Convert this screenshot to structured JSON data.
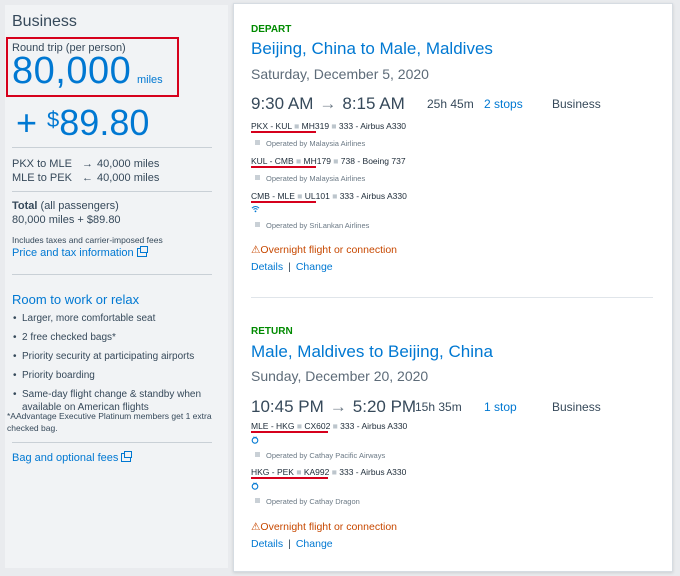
{
  "summary": {
    "cabin_title": "Business",
    "round_trip_label": "Round trip (per person)",
    "miles": "80,000",
    "miles_unit": "miles",
    "price_plus": "+ ",
    "price_dollar": "$",
    "price_amount": "89.80",
    "segments": [
      {
        "route": "PKX to MLE",
        "arrow": "→",
        "miles": "40,000 miles"
      },
      {
        "route": "MLE to PEK",
        "arrow": "←",
        "miles": "40,000 miles"
      }
    ],
    "total_label": "Total",
    "total_suffix": " (all passengers)",
    "total_value": "80,000 miles + $89.80",
    "includes_text": "Includes taxes and carrier-imposed fees",
    "price_tax_link": "Price and tax information",
    "room_heading": "Room to work or relax",
    "perks": [
      "Larger, more comfortable seat",
      "2 free checked bags*",
      "Priority security at participating airports",
      "Priority boarding",
      "Same-day flight change & standby when available on American flights"
    ],
    "footnote": "*AAdvantage Executive Platinum members get 1 extra checked bag.",
    "bag_fees_link": "Bag and optional fees"
  },
  "depart": {
    "label": "DEPART",
    "route": "Beijing, China to Male, Maldives",
    "date": "Saturday, December 5, 2020",
    "depart_time": "9:30 AM",
    "arrow": "→",
    "arrive_time": "8:15 AM",
    "duration": "25h 45m",
    "stops": "2 stops",
    "cabin": "Business",
    "flights": [
      {
        "route": "PKX - KUL",
        "flight": "MH319",
        "aircraft": "333 - Airbus A330",
        "operated": "Operated by Malaysia Airlines",
        "amenity": ""
      },
      {
        "route": "KUL - CMB",
        "flight": "MH179",
        "aircraft": "738 - Boeing 737",
        "operated": "Operated by Malaysia Airlines",
        "amenity": ""
      },
      {
        "route": "CMB - MLE",
        "flight": "UL101",
        "aircraft": "333 - Airbus A330",
        "operated": "Operated by SriLankan Airlines",
        "amenity": "wifi-icon"
      }
    ],
    "warning": "Overnight flight or connection",
    "details": "Details",
    "change": "Change"
  },
  "return": {
    "label": "RETURN",
    "route": "Male, Maldives to Beijing, China",
    "date": "Sunday, December 20, 2020",
    "depart_time": "10:45 PM",
    "arrow": "→",
    "arrive_time": "5:20 PM",
    "duration": "15h 35m",
    "stops": "1 stop",
    "cabin": "Business",
    "flights": [
      {
        "route": "MLE - HKG",
        "flight": "CX602",
        "aircraft": "333 - Airbus A330",
        "operated": "Operated by Cathay Pacific Airways",
        "amenity": "power-icon"
      },
      {
        "route": "HKG - PEK",
        "flight": "KA992",
        "aircraft": "333 - Airbus A330",
        "operated": "Operated by Cathay Dragon",
        "amenity": "power-icon"
      }
    ],
    "warning": "Overnight flight or connection",
    "details": "Details",
    "change": "Change"
  },
  "colors": {
    "accent": "#0078d2",
    "green": "#008a00",
    "warning": "#c74800",
    "highlight": "#d6001c"
  }
}
